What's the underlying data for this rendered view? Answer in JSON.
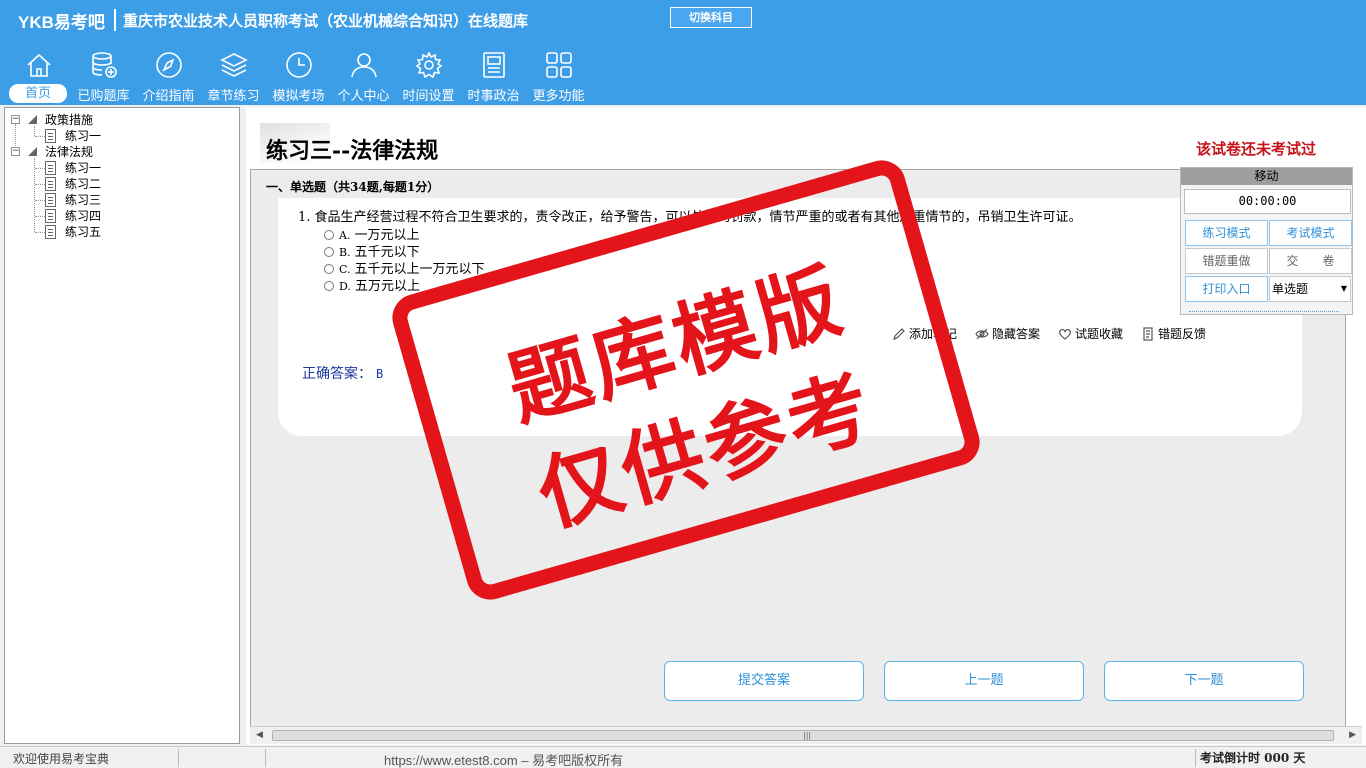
{
  "header": {
    "brand": "YKB易考吧",
    "title": "重庆市农业技术人员职称考试（农业机械综合知识）在线题库",
    "switch_button": "切换科目"
  },
  "nav": [
    {
      "label": "首页",
      "icon": "home-icon"
    },
    {
      "label": "已购题库",
      "icon": "database-icon"
    },
    {
      "label": "介绍指南",
      "icon": "compass-icon"
    },
    {
      "label": "章节练习",
      "icon": "layers-icon"
    },
    {
      "label": "模拟考场",
      "icon": "clock-icon"
    },
    {
      "label": "个人中心",
      "icon": "user-icon"
    },
    {
      "label": "时间设置",
      "icon": "gear-icon"
    },
    {
      "label": "时事政治",
      "icon": "news-icon"
    },
    {
      "label": "更多功能",
      "icon": "grid-icon"
    }
  ],
  "tree": {
    "groups": [
      {
        "label": "政策措施",
        "items": [
          "练习一"
        ]
      },
      {
        "label": "法律法规",
        "items": [
          "练习一",
          "练习二",
          "练习三",
          "练习四",
          "练习五"
        ]
      }
    ]
  },
  "exam": {
    "title": "练习三--法律法规",
    "status": "该试卷还未考试过",
    "section_header": "一、单选题（共34题,每题1分）",
    "question": "1. 食品生产经营过程不符合卫生要求的，责令改正，给予警告，可以处以的罚款，情节严重的或者有其他严重情节的，吊销卫生许可证。",
    "options": [
      {
        "letter": "A.",
        "text": "一万元以上"
      },
      {
        "letter": "B.",
        "text": "五千元以下"
      },
      {
        "letter": "C.",
        "text": "五千元以上一万元以下"
      },
      {
        "letter": "D.",
        "text": "五万元以上"
      }
    ],
    "tools": [
      "添加笔记",
      "隐藏答案",
      "试题收藏",
      "错题反馈"
    ],
    "answer_label": "正确答案：",
    "answer_value": "B"
  },
  "buttons": {
    "submit": "提交答案",
    "prev": "上一题",
    "next": "下一题"
  },
  "control": {
    "title": "移动",
    "timer": "00:00:00",
    "practice_mode": "练习模式",
    "exam_mode": "考试模式",
    "redo_wrong": "错题重做",
    "hand_in": "交　　卷",
    "print": "打印入口",
    "question_type": "单选题"
  },
  "watermark": {
    "line1": "题库模版",
    "line2": "仅供参考"
  },
  "statusbar": {
    "welcome": "欢迎使用易考宝典",
    "url": "https://www.etest8.com – 易考吧版权所有",
    "countdown": "考试倒计时 000 天"
  },
  "colors": {
    "header_bg": "#3d9ee8",
    "stamp_red": "#e4141b",
    "status_red": "#c7141a",
    "answer_blue": "#1a3aa0"
  }
}
